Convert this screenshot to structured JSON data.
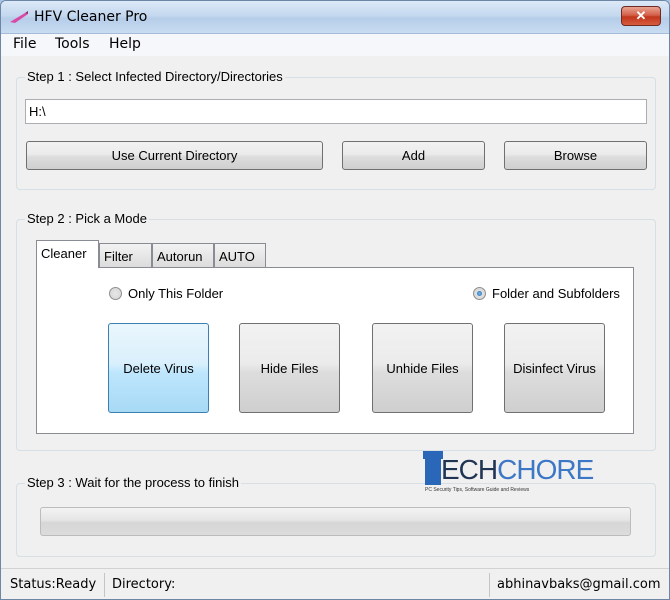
{
  "window": {
    "title": "HFV Cleaner Pro",
    "close_label": "✕"
  },
  "menu": {
    "file": "File",
    "tools": "Tools",
    "help": "Help"
  },
  "step1": {
    "label": "Step 1 : Select Infected Directory/Directories",
    "directory_value": "H:\\",
    "use_current_label": "Use Current Directory",
    "add_label": "Add",
    "browse_label": "Browse"
  },
  "step2": {
    "label": "Step 2 : Pick a Mode",
    "tabs": [
      "Cleaner",
      "Filter",
      "Autorun",
      "AUTO"
    ],
    "selected_tab": "Cleaner",
    "radio_only_this_folder": "Only This Folder",
    "radio_folder_and_subfolders": "Folder and Subfolders",
    "selected_radio": "Folder and Subfolders",
    "buttons": {
      "delete_virus": "Delete Virus",
      "hide_files": "Hide Files",
      "unhide_files": "Unhide Files",
      "disinfect_virus": "Disinfect Virus"
    }
  },
  "logo": {
    "letter_t": "T",
    "text_dark": "ECH",
    "text_light": "CHORE",
    "tagline": "PC Security Tips, Software Guide and Reviews",
    "color_primary": "#2a67b8"
  },
  "step3": {
    "label": "Step 3 : Wait for the process to finish",
    "progress_percent": 0
  },
  "status": {
    "status_text": "Status:Ready",
    "directory_text": "Directory:",
    "email": "abhinavbaks@gmail.com"
  },
  "colors": {
    "window_bg": "#f0f0f0",
    "active_button": "#bee6fd",
    "close_button": "#c0361c"
  }
}
